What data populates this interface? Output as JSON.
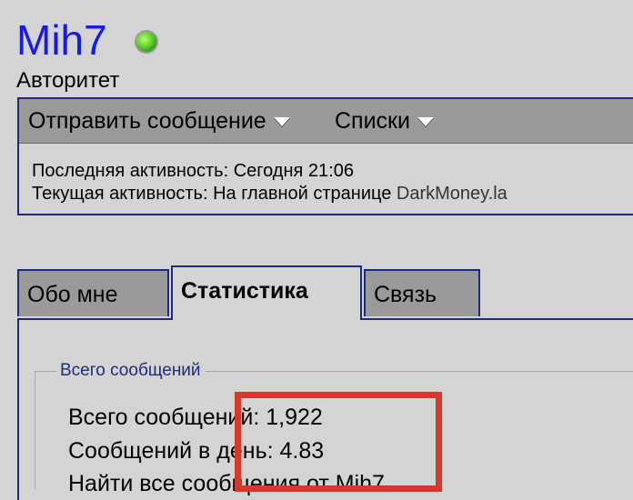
{
  "profile": {
    "username": "Mih7",
    "usertitle": "Авторитет",
    "status_color": "#5fd12e"
  },
  "menu": {
    "send_message": "Отправить сообщение",
    "lists": "Списки"
  },
  "activity": {
    "last": "Последняя активность: Сегодня 21:06",
    "current_label": "Текущая активность: На главной странице",
    "current_link": "DarkMoney.la"
  },
  "tabs": [
    {
      "label": "Обо мне",
      "active": false
    },
    {
      "label": "Статистика",
      "active": true
    },
    {
      "label": "Связь",
      "active": false
    }
  ],
  "stats": {
    "legend": "Всего сообщений",
    "total_posts": "Всего сообщений: 1,922",
    "posts_per_day": "Сообщений в день: 4.83",
    "partial_line": "Найти все сообщения от Mih7"
  },
  "colors": {
    "link": "#1a1ae6",
    "border": "#1f2a7a",
    "highlight": "#d8382a"
  }
}
